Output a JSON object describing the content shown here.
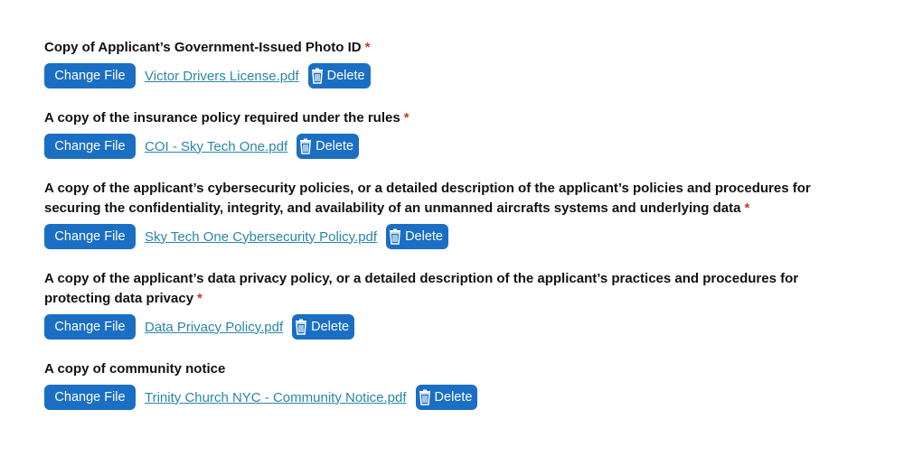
{
  "fields": [
    {
      "label": "Copy of Applicant’s Government-Issued Photo ID",
      "required_mark": "*",
      "change_label": "Change File",
      "file_name": "Victor Drivers License.pdf",
      "delete_label": "Delete"
    },
    {
      "label": "A copy of the insurance policy required under the rules",
      "required_mark": "*",
      "change_label": "Change File",
      "file_name": "COI - Sky Tech One.pdf",
      "delete_label": "Delete"
    },
    {
      "label": "A copy of the applicant’s cybersecurity policies, or a detailed description of the applicant’s policies and procedures for securing the confidentiality, integrity, and availability of an unmanned aircrafts systems and underlying data",
      "required_mark": "*",
      "change_label": "Change File",
      "file_name": "Sky Tech One Cybersecurity Policy.pdf",
      "delete_label": "Delete"
    },
    {
      "label": "A copy of the applicant’s data privacy policy, or a detailed description of the applicant’s practices and procedures for protecting data privacy",
      "required_mark": "*",
      "change_label": "Change File",
      "file_name": "Data Privacy Policy.pdf",
      "delete_label": "Delete"
    },
    {
      "label": "A copy of community notice",
      "required_mark": "",
      "change_label": "Change File",
      "file_name": "Trinity Church NYC - Community Notice.pdf",
      "delete_label": "Delete"
    }
  ],
  "colors": {
    "button_bg": "#1a6fc4",
    "link": "#2a86a8",
    "required": "#c0392b"
  },
  "icons": {
    "delete": "trash-icon"
  }
}
